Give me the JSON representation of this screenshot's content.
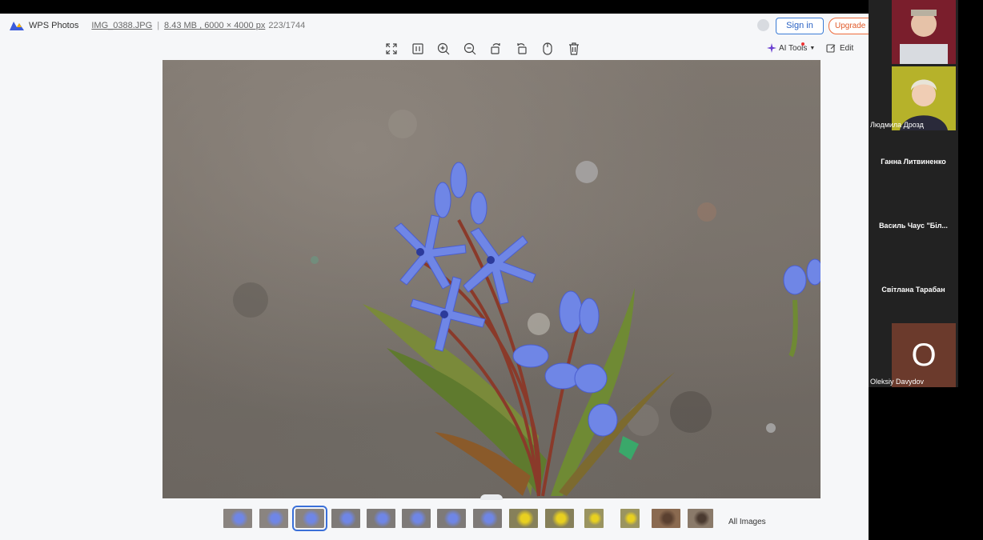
{
  "app": {
    "name": "WPS Photos",
    "file_name": "IMG_0388.JPG",
    "file_size": "8.43 MB",
    "dimensions": "6000 × 4000 px",
    "counter": "223/1744",
    "sign_in_label": "Sign in",
    "upgrade_label": "Upgrade N"
  },
  "toolbar": {
    "tools": [
      "fullscreen-icon",
      "fit-icon",
      "zoom-in-icon",
      "zoom-out-icon",
      "rotate-left-icon",
      "rotate-right-icon",
      "mouse-icon",
      "trash-icon"
    ],
    "ai_tools_label": "AI Tools",
    "edit_label": "Edit"
  },
  "thumbnails": {
    "count": 14,
    "active_index": 2,
    "all_images_label": "All Images"
  },
  "call": {
    "participants": [
      {
        "name": "",
        "type": "video"
      },
      {
        "name": "Людмила Дрозд",
        "type": "video"
      },
      {
        "name": "Ганна Литвиненко",
        "type": "name"
      },
      {
        "name": "Василь Чаус \"Біл...",
        "type": "name"
      },
      {
        "name": "Світлана Тарабан",
        "type": "name"
      },
      {
        "name": "Oleksiy Davydov",
        "initial": "O",
        "type": "initial"
      }
    ]
  },
  "colors": {
    "accent": "#3a6fd8",
    "upgrade": "#e05a2a",
    "avatar_bg": "#6b3a2c"
  }
}
